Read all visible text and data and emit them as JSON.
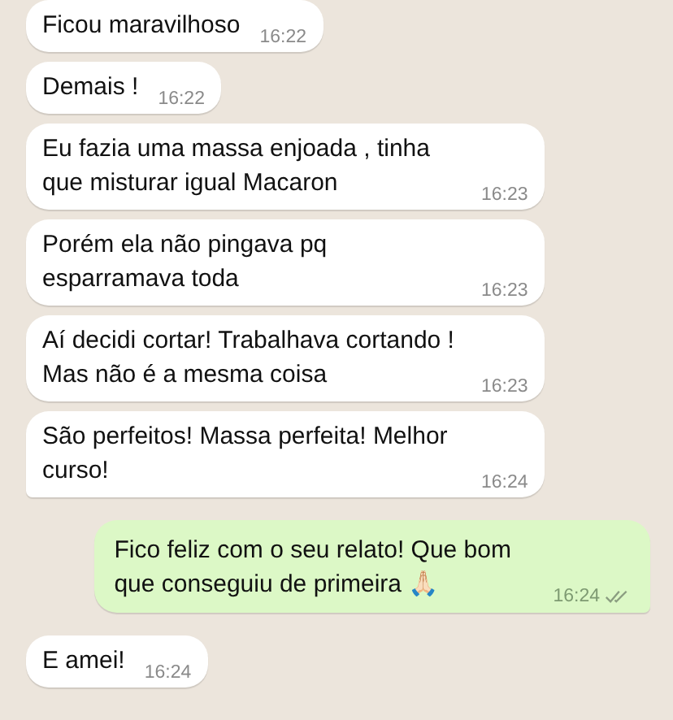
{
  "messages": [
    {
      "kind": "incoming",
      "text": "Ficou maravilhoso",
      "time": "16:22",
      "tail": false
    },
    {
      "kind": "incoming",
      "text": "Demais !",
      "time": "16:22",
      "tail": false
    },
    {
      "kind": "incoming",
      "text": "Eu fazia uma massa enjoada , tinha que misturar igual Macaron",
      "time": "16:23",
      "tail": false
    },
    {
      "kind": "incoming",
      "text": "Porém ela não pingava pq esparramava toda",
      "time": "16:23",
      "tail": false
    },
    {
      "kind": "incoming",
      "text": "Aí decidi cortar! Trabalhava cortando ! Mas não é a mesma coisa",
      "time": "16:23",
      "tail": false
    },
    {
      "kind": "incoming",
      "text": "São perfeitos! Massa perfeita! Melhor curso!",
      "time": "16:24",
      "tail": true
    },
    {
      "kind": "outgoing",
      "text": "Fico feliz com o seu relato! Que bom que conseguiu de primeira 🙏🏻",
      "time": "16:24",
      "tail": true,
      "read": false
    },
    {
      "kind": "incoming",
      "text": "E amei!",
      "time": "16:24",
      "tail": false
    }
  ]
}
